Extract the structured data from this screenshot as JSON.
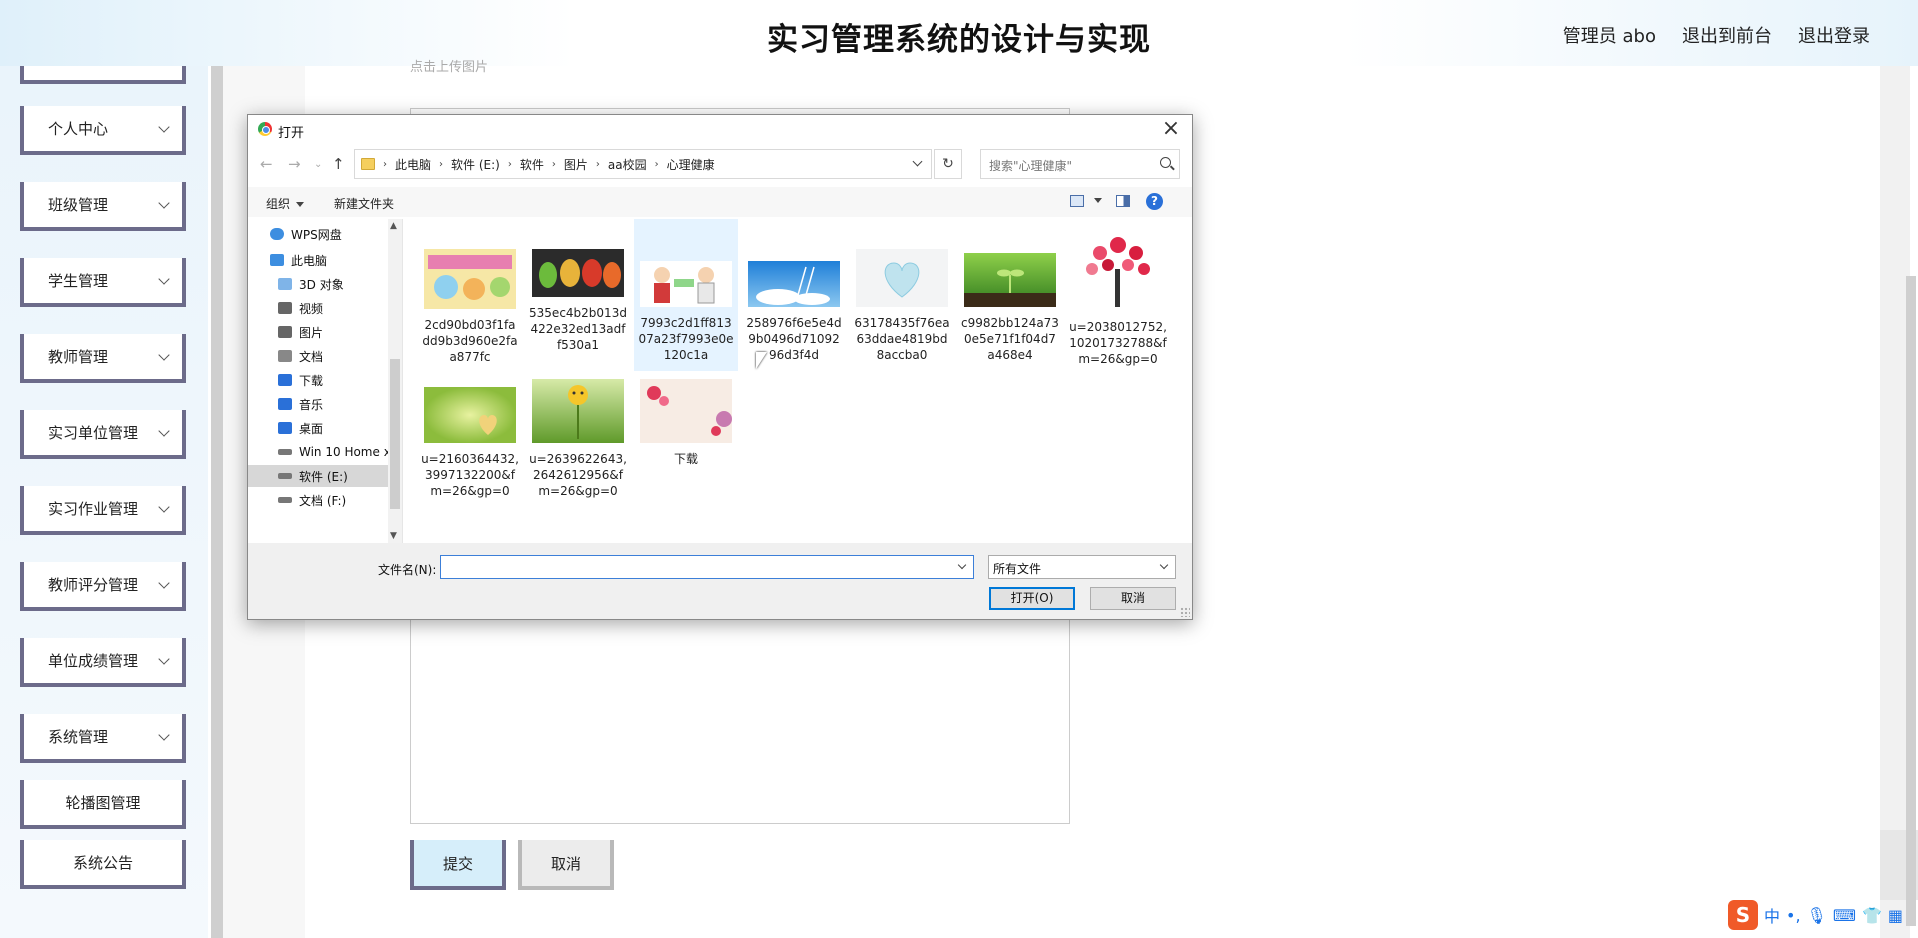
{
  "header": {
    "title": "实习管理系统的设计与实现",
    "links": [
      "管理员 abo",
      "退出到前台",
      "退出登录"
    ]
  },
  "sidebar": {
    "items": [
      {
        "label": "个人中心",
        "expandable": true
      },
      {
        "label": "班级管理",
        "expandable": true
      },
      {
        "label": "学生管理",
        "expandable": true
      },
      {
        "label": "教师管理",
        "expandable": true
      },
      {
        "label": "实习单位管理",
        "expandable": true
      },
      {
        "label": "实习作业管理",
        "expandable": true
      },
      {
        "label": "教师评分管理",
        "expandable": true
      },
      {
        "label": "单位成绩管理",
        "expandable": true
      },
      {
        "label": "系统管理",
        "expandable": true
      },
      {
        "label": "轮播图管理",
        "expandable": false
      },
      {
        "label": "系统公告",
        "expandable": false
      }
    ]
  },
  "form": {
    "upload_hint": "点击上传图片",
    "submit_label": "提交",
    "cancel_label": "取消"
  },
  "dialog": {
    "title": "打开",
    "breadcrumbs": [
      "此电脑",
      "软件 (E:)",
      "软件",
      "图片",
      "aa校园",
      "心理健康"
    ],
    "search_placeholder": "搜索\"心理健康\"",
    "toolbar": {
      "organize": "组织",
      "new_folder": "新建文件夹"
    },
    "nav_tree": [
      {
        "label": "WPS网盘",
        "icon": "cloud-icon",
        "color": "#3d8ee0"
      },
      {
        "label": "此电脑",
        "icon": "computer-icon",
        "color": "#3d8ee0"
      },
      {
        "label": "3D 对象",
        "icon": "cube-icon",
        "color": "#7fb4e8"
      },
      {
        "label": "视频",
        "icon": "video-icon",
        "color": "#666666"
      },
      {
        "label": "图片",
        "icon": "picture-icon",
        "color": "#666666"
      },
      {
        "label": "文档",
        "icon": "document-icon",
        "color": "#888888"
      },
      {
        "label": "下载",
        "icon": "download-icon",
        "color": "#2a70d8"
      },
      {
        "label": "音乐",
        "icon": "music-icon",
        "color": "#2a70d8"
      },
      {
        "label": "桌面",
        "icon": "desktop-icon",
        "color": "#2a70d8"
      },
      {
        "label": "Win 10 Home x",
        "icon": "drive-icon",
        "color": "#777777"
      },
      {
        "label": "软件 (E:)",
        "icon": "drive-icon",
        "color": "#777777"
      },
      {
        "label": "文档 (F:)",
        "icon": "drive-icon",
        "color": "#777777"
      }
    ],
    "files": [
      {
        "name": "2cd90bd03f1fadd9b3d960e2faa877fc",
        "thumb": "psych-poster"
      },
      {
        "name": "535ec4b2b013d422e32ed13adff530a1",
        "thumb": "leaf-faces"
      },
      {
        "name": "7993c2d1ff81307a23f7993e0e120c1a",
        "thumb": "doctor-cartoon"
      },
      {
        "name": "258976f6e5e4d9b0496d7109296d3f4d",
        "thumb": "blue-sky-ladder"
      },
      {
        "name": "63178435f76ea63ddae4819bd8accba0",
        "thumb": "heart-balloon"
      },
      {
        "name": "c9982bb124a730e5e71f1f04d7a468e4",
        "thumb": "sprout"
      },
      {
        "name": "u=2038012752,10201732788&fm=26&gp=0",
        "thumb": "heart-tree"
      },
      {
        "name": "u=2160364432,3997132200&fm=26&gp=0",
        "thumb": "green-heart"
      },
      {
        "name": "u=2639622643,2642612956&fm=26&gp=0",
        "thumb": "smiley-flower"
      },
      {
        "name": "下载",
        "thumb": "flowers-pink"
      }
    ],
    "filename_label": "文件名(N):",
    "filename_value": "",
    "filetype_value": "所有文件",
    "open_label": "打开(O)",
    "cancel_label": "取消"
  },
  "ime": {
    "mode": "中"
  }
}
